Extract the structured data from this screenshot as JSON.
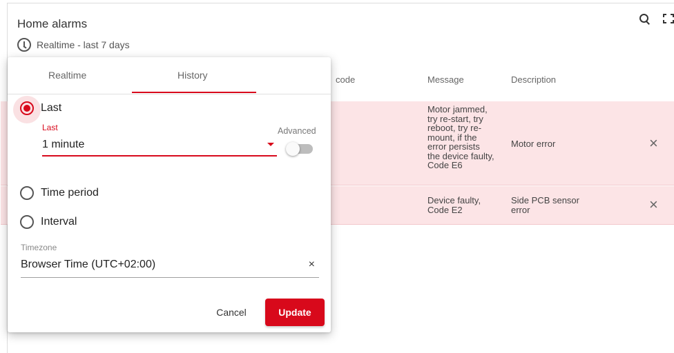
{
  "widget": {
    "title": "Home alarms",
    "subtitle": "Realtime - last 7 days",
    "icons": [
      "clock-icon",
      "search-icon",
      "fullscreen-icon"
    ]
  },
  "table": {
    "columns": [
      "code",
      "Message",
      "Description"
    ],
    "rows": [
      {
        "message_lines": [
          "Motor jammed,",
          "try re-start, try",
          "reboot, try re-",
          "mount, if the",
          "error persists",
          "the device faulty,",
          "Code E6"
        ],
        "description_lines": [
          "Motor error"
        ],
        "action": "×"
      },
      {
        "message_lines": [
          "Device faulty,",
          "Code E2"
        ],
        "description_lines": [
          "Side PCB sensor",
          "error"
        ],
        "action": "×"
      }
    ],
    "row_color": "#fce4e6"
  },
  "timewindow": {
    "tabs": [
      "Realtime",
      "History"
    ],
    "active_tab": "History",
    "options": {
      "last": "Last",
      "time_period": "Time period",
      "interval": "Interval"
    },
    "selected_option": "Last",
    "last_field": {
      "label": "Last",
      "value": "1 minute"
    },
    "advanced_label": "Advanced",
    "advanced_on": false,
    "timezone": {
      "label": "Timezone",
      "value": "Browser Time (UTC+02:00)",
      "clear": "×"
    },
    "cancel_label": "Cancel",
    "update_label": "Update",
    "accent_color": "#d8091b"
  }
}
